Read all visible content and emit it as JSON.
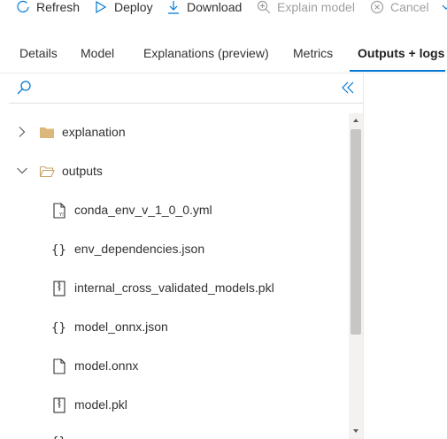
{
  "toolbar": {
    "refresh": "Refresh",
    "deploy": "Deploy",
    "download": "Download",
    "explain_model": "Explain model",
    "cancel": "Cancel"
  },
  "tabs": [
    {
      "label": "Details"
    },
    {
      "label": "Model"
    },
    {
      "label": "Explanations (preview)"
    },
    {
      "label": "Metrics"
    },
    {
      "label": "Outputs + logs",
      "active": true
    }
  ],
  "tree": [
    {
      "label": "explanation",
      "type": "folder",
      "expanded": false
    },
    {
      "label": "outputs",
      "type": "folder",
      "expanded": true
    },
    {
      "label": "conda_env_v_1_0_0.yml",
      "type": "yml-file"
    },
    {
      "label": "env_dependencies.json",
      "type": "json-file"
    },
    {
      "label": "internal_cross_validated_models.pkl",
      "type": "zip-file"
    },
    {
      "label": "model_onnx.json",
      "type": "json-file"
    },
    {
      "label": "model.onnx",
      "type": "file"
    },
    {
      "label": "model.pkl",
      "type": "zip-file"
    }
  ],
  "colors": {
    "accent": "#0078d4",
    "folder": "#dcb67a",
    "text": "#323130",
    "disabled": "#a19f9d"
  }
}
